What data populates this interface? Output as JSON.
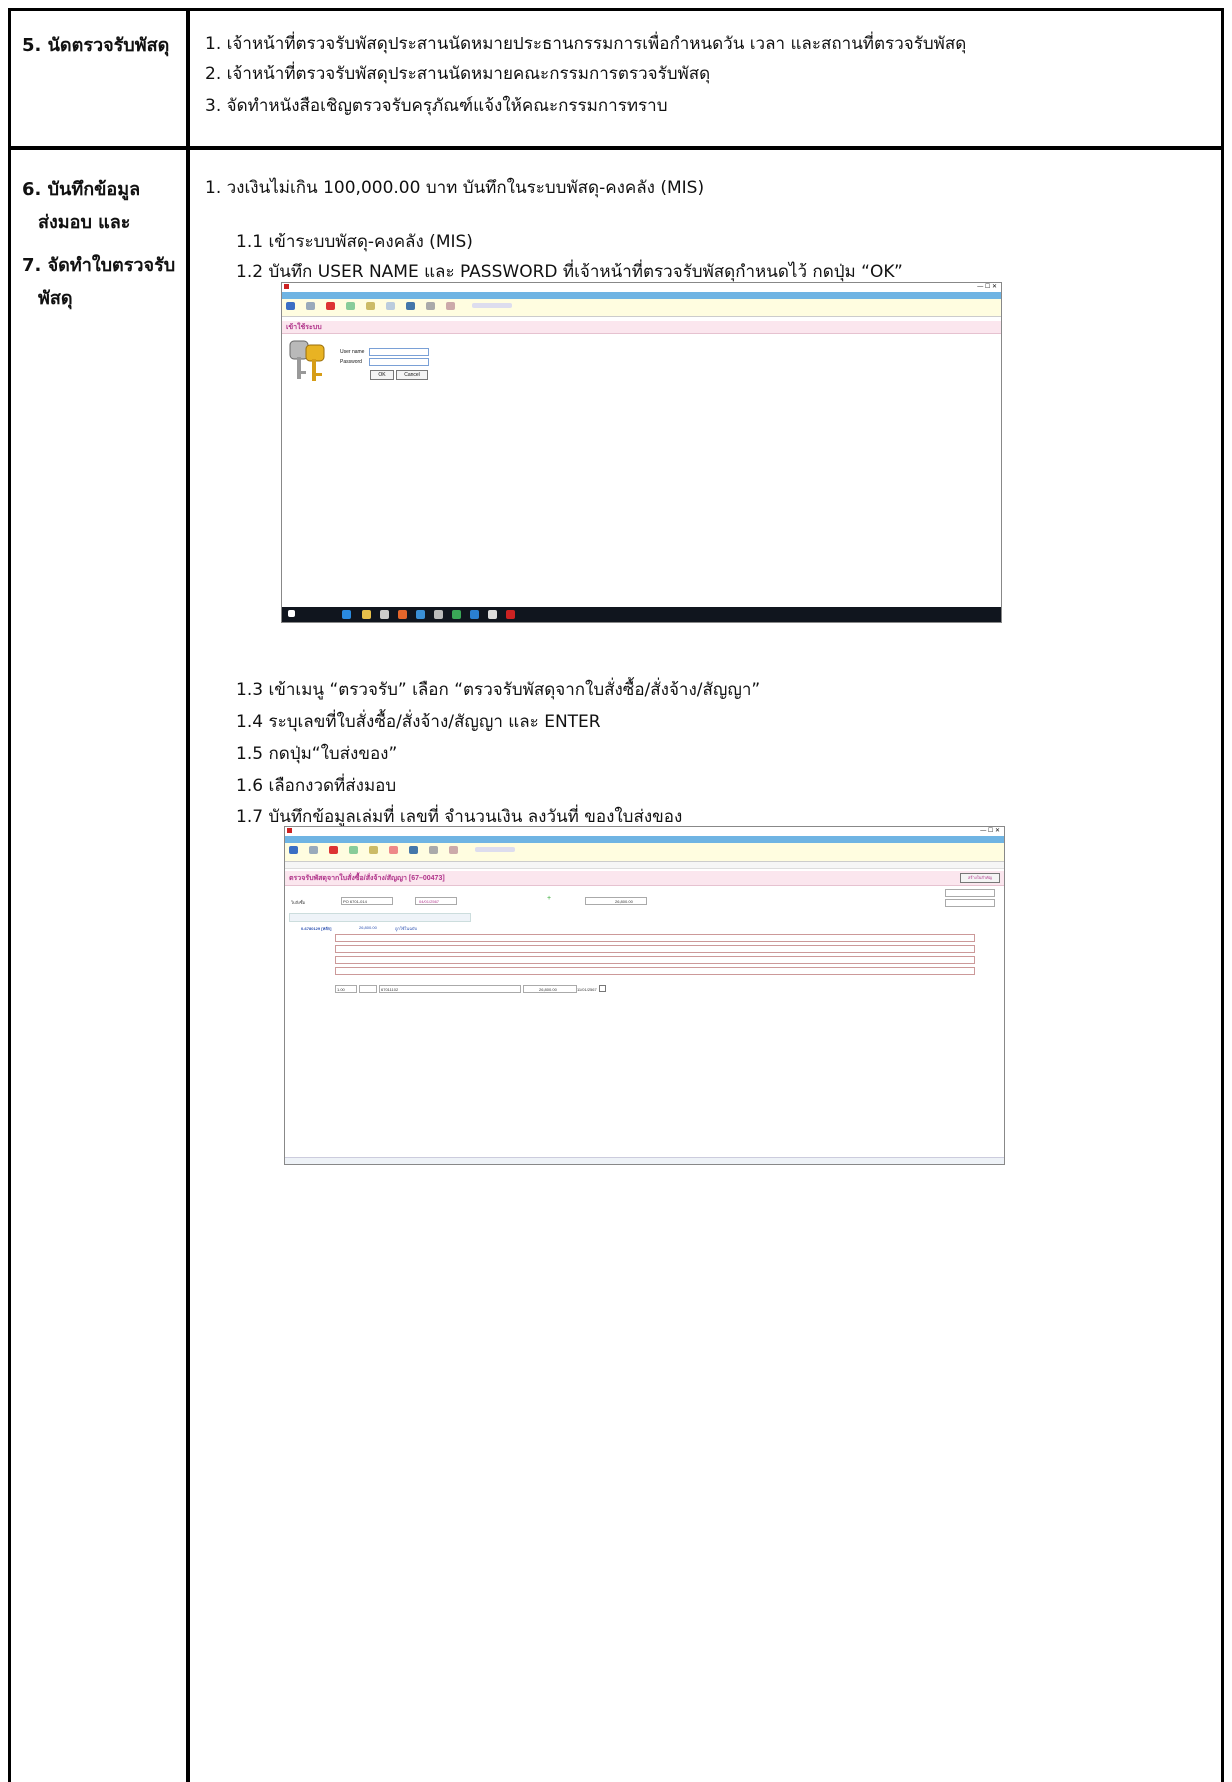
{
  "section5": {
    "heading": "5.  นัดตรวจรับพัสดุ",
    "items": [
      "1.  เจ้าหน้าที่ตรวจรับพัสดุประสานนัดหมายประธานกรรมการเพื่อกำหนดวัน เวลา และสถานที่ตรวจรับพัสดุ",
      "2.  เจ้าหน้าที่ตรวจรับพัสดุประสานนัดหมายคณะกรรมการตรวจรับพัสดุ",
      "3.  จัดทำหนังสือเชิญตรวจรับครุภัณฑ์แจ้งให้คณะกรรมการทราบ"
    ]
  },
  "section6": {
    "heading_lines": [
      "6. บันทึกข้อมูล",
      "ส่งมอบ  และ",
      "7. จัดทำใบตรวจรับ",
      "พัสดุ"
    ],
    "intro": "1. วงเงินไม่เกิน 100,000.00 บาท บันทึกในระบบพัสดุ-คงคลัง (MIS)",
    "steps_a": [
      "1.1  เข้าระบบพัสดุ-คงคลัง (MIS)",
      "1.2  บันทึก USER NAME และ PASSWORD ที่เจ้าหน้าที่ตรวจรับพัสดุกำหนดไว้ กดปุ่ม “OK”"
    ],
    "steps_b": [
      "1.3   เข้าเมนู “ตรวจรับ” เลือก “ตรวจรับพัสดุจากใบสั่งซื้อ/สั่งจ้าง/สัญญา”",
      "1.4  ระบุเลขที่ใบสั่งซื้อ/สั่งจ้าง/สัญญา และ ENTER",
      "1.5  กดปุ่ม“ใบส่งของ”",
      "1.6  เลือกงวดที่ส่งมอบ",
      "1.7  บันทึกข้อมูลเล่มที่ เลขที่ จำนวนเงิน ลงวันที่ ของใบส่งของ"
    ]
  },
  "login_screen": {
    "title": "เข้าใช้ระบบ",
    "username_label": "User name",
    "password_label": "Password",
    "ok_label": "OK",
    "cancel_label": "Cancel",
    "menubar_color": "#6fb4e3",
    "strip_color": "#fbe6ee"
  },
  "receive_screen": {
    "title": "ตรวจรับพัสดุจากใบสั่งซื้อ/สั่งจ้าง/สัญญา [67–00473]",
    "create_button": "สร้างใบสำคัญ",
    "doc_no": "PO 6701-014",
    "doc_date": "04/01/2567",
    "amount": "26,800.00",
    "doc_type": "ใบสั่งซื้อ",
    "record_id": "0-6780129 [หลัก]",
    "record_amount": "26,800.00",
    "record_status": "ถูกใช้ในฉบับ",
    "installment": "1.00",
    "delivery_no": "67011102",
    "delivery_amount": "26,800.00",
    "delivery_date": "11/01/2567",
    "title_color": "#b0338a"
  }
}
